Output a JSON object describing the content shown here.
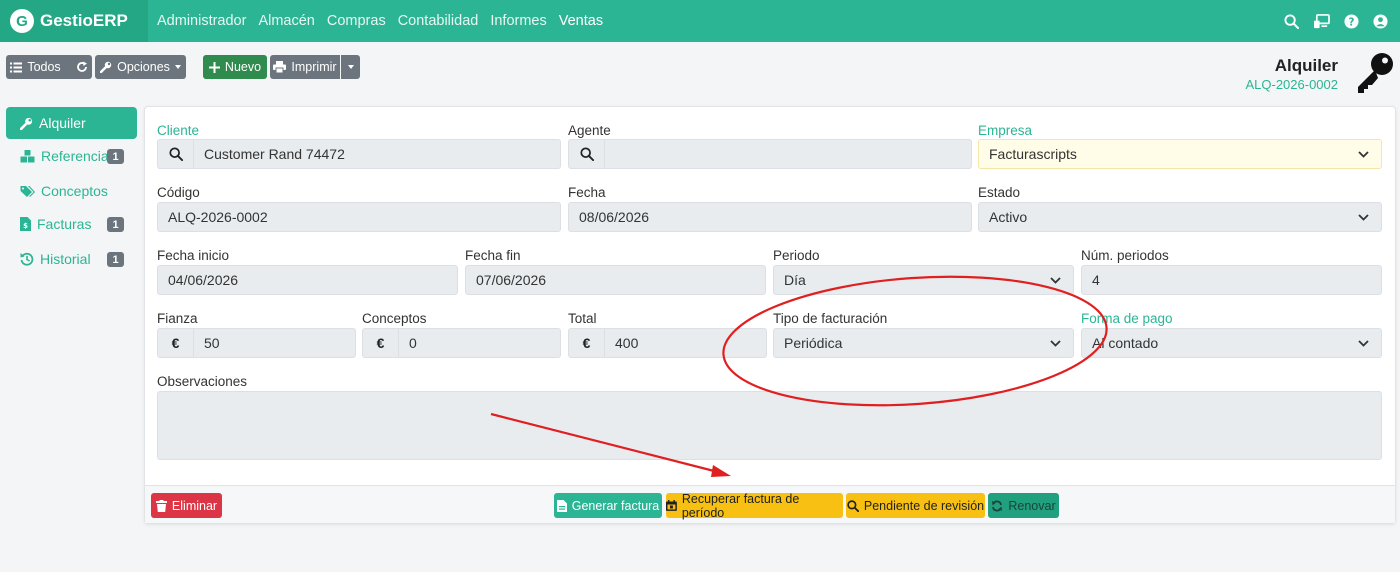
{
  "navbar": {
    "brand_initial": "G",
    "brand_name": "GestioERP",
    "menu": [
      "Administrador",
      "Almacén",
      "Compras",
      "Contabilidad",
      "Informes",
      "Ventas"
    ],
    "icons": [
      "search-icon",
      "monitor-icon",
      "help-icon",
      "user-icon"
    ]
  },
  "toolbar": {
    "all_label": "Todos",
    "options_label": "Opciones",
    "new_label": "Nuevo",
    "print_label": "Imprimir"
  },
  "document": {
    "title": "Alquiler",
    "code": "ALQ-2026-0002"
  },
  "sidebar": {
    "items": [
      {
        "label": "Alquiler",
        "icon": "wrench-icon",
        "badge": ""
      },
      {
        "label": "Referencias",
        "icon": "cubes-icon",
        "badge": "1"
      },
      {
        "label": "Conceptos",
        "icon": "tags-icon",
        "badge": ""
      },
      {
        "label": "Facturas",
        "icon": "invoice-icon",
        "badge": "1"
      },
      {
        "label": "Historial",
        "icon": "history-icon",
        "badge": "1"
      }
    ]
  },
  "form": {
    "cliente": {
      "label": "Cliente",
      "value": "Customer Rand 74472"
    },
    "agente": {
      "label": "Agente",
      "value": ""
    },
    "empresa": {
      "label": "Empresa",
      "value": "Facturascripts"
    },
    "codigo": {
      "label": "Código",
      "value": "ALQ-2026-0002"
    },
    "fecha": {
      "label": "Fecha",
      "value": "08/06/2026"
    },
    "estado": {
      "label": "Estado",
      "value": "Activo"
    },
    "fecha_inicio": {
      "label": "Fecha inicio",
      "value": "04/06/2026"
    },
    "fecha_fin": {
      "label": "Fecha fin",
      "value": "07/06/2026"
    },
    "periodo": {
      "label": "Periodo",
      "value": "Día"
    },
    "num_periodos": {
      "label": "Núm. periodos",
      "value": "4"
    },
    "fianza": {
      "label": "Fianza",
      "value": "50",
      "currency": "€"
    },
    "conceptos": {
      "label": "Conceptos",
      "value": "0",
      "currency": "€"
    },
    "total": {
      "label": "Total",
      "value": "400",
      "currency": "€"
    },
    "tipo_facturacion": {
      "label": "Tipo de facturación",
      "value": "Periódica"
    },
    "forma_pago": {
      "label": "Forma de pago",
      "value": "Al contado"
    },
    "observaciones": {
      "label": "Observaciones",
      "value": ""
    }
  },
  "footer": {
    "delete_label": "Eliminar",
    "generate_label": "Generar factura",
    "recover_label": "Recuperar factura de período",
    "pending_label": "Pendiente de revisión",
    "renew_label": "Renovar"
  },
  "colors": {
    "brand": "#2bb594",
    "danger": "#dc3545",
    "warning": "#f7c012",
    "annotation": "#e02020"
  }
}
